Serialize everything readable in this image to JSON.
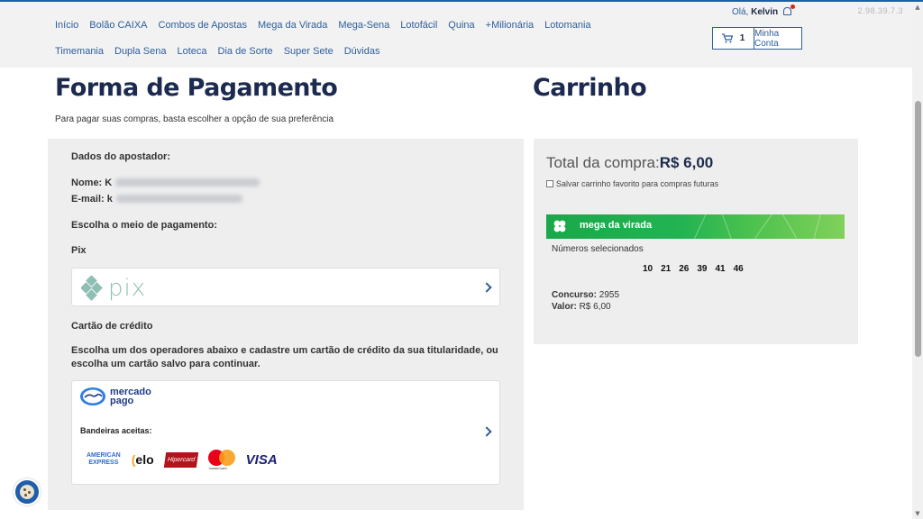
{
  "header": {
    "version": "2.98.39.7.3",
    "nav": [
      "Início",
      "Bolão CAIXA",
      "Combos de Apostas",
      "Mega da Virada",
      "Mega-Sena",
      "Lotofácil",
      "Quina",
      "+Milionária",
      "Lotomania",
      "Timemania",
      "Dupla Sena",
      "Loteca",
      "Dia de Sorte",
      "Super Sete",
      "Dúvidas"
    ],
    "greeting_prefix": "Olá, ",
    "user_name": "Kelvin",
    "cart_count": "1",
    "account_label": "Minha Conta"
  },
  "payment": {
    "title": "Forma de Pagamento",
    "subtitle": "Para pagar suas compras, basta escolher a opção de sua preferência",
    "bettor_heading": "Dados do apostador:",
    "name_label": "Nome:",
    "name_value": "K",
    "email_label": "E-mail:",
    "email_value": "k",
    "choose_method": "Escolha o meio de pagamento:",
    "pix_heading": "Pix",
    "pix_logo_text": "pix",
    "credit_heading": "Cartão de crédito",
    "credit_instructions": "Escolha um dos operadores abaixo e cadastre um cartão de crédito da sua titularidade, ou escolha um cartão salvo para continuar.",
    "mercadopago_line1": "mercado",
    "mercadopago_line2": "pago",
    "brands_label": "Bandeiras aceitas:",
    "brand_amex_1": "AMERICAN",
    "brand_amex_2": "EXPRESS",
    "brand_elo": "elo",
    "brand_hipercard": "Hipercard",
    "brand_mastercard": "mastercard",
    "brand_visa": "VISA"
  },
  "cart": {
    "title": "Carrinho",
    "total_label": "Total da compra:",
    "total_value": "R$ 6,00",
    "save_label": "Salvar carrinho favorito para compras futuras",
    "game_name": "mega da virada",
    "numbers_label": "Números selecionados",
    "numbers": [
      "10",
      "21",
      "26",
      "39",
      "41",
      "46"
    ],
    "contest_label": "Concurso:",
    "contest_value": "2955",
    "value_label": "Valor:",
    "value_value": "R$ 6,00"
  },
  "colors": {
    "accent": "#2e5e9e",
    "heading": "#1b2a4e",
    "banner": "#22b352",
    "pix": "#8fbfb4"
  }
}
